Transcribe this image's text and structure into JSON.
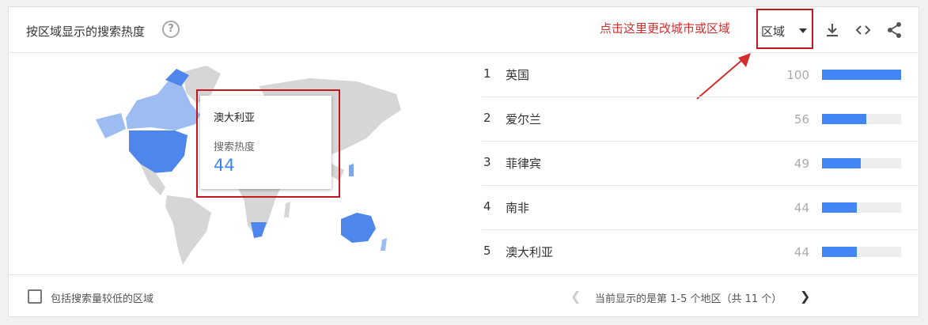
{
  "header": {
    "title": "按区域显示的搜索热度",
    "help_icon": "help-circle-icon",
    "annotation": "点击这里更改城市或区域",
    "region_select": {
      "selected": "区域"
    },
    "icons": [
      "download-icon",
      "embed-code-icon",
      "share-icon"
    ]
  },
  "tooltip": {
    "region": "澳大利亚",
    "label": "搜索热度",
    "value": "44"
  },
  "rankings": [
    {
      "rank": "1",
      "name": "英国",
      "value": "100",
      "fraction": 1.0
    },
    {
      "rank": "2",
      "name": "爱尔兰",
      "value": "56",
      "fraction": 0.56
    },
    {
      "rank": "3",
      "name": "菲律宾",
      "value": "49",
      "fraction": 0.49
    },
    {
      "rank": "4",
      "name": "南非",
      "value": "44",
      "fraction": 0.44
    },
    {
      "rank": "5",
      "name": "澳大利亚",
      "value": "44",
      "fraction": 0.44
    }
  ],
  "footer": {
    "checkbox_label": "包括搜索量较低的区域",
    "checkbox_checked": false,
    "pagination_text": "当前显示的是第 1-5 个地区（共 11 个）",
    "prev_icon": "chevron-left-icon",
    "next_icon": "chevron-right-icon"
  },
  "colors": {
    "accent": "#4285f4",
    "highlight_box": "#c4161c",
    "map_land": "#d6d6d6",
    "map_high": "#4f86ec",
    "map_low": "#9cbcf2"
  }
}
